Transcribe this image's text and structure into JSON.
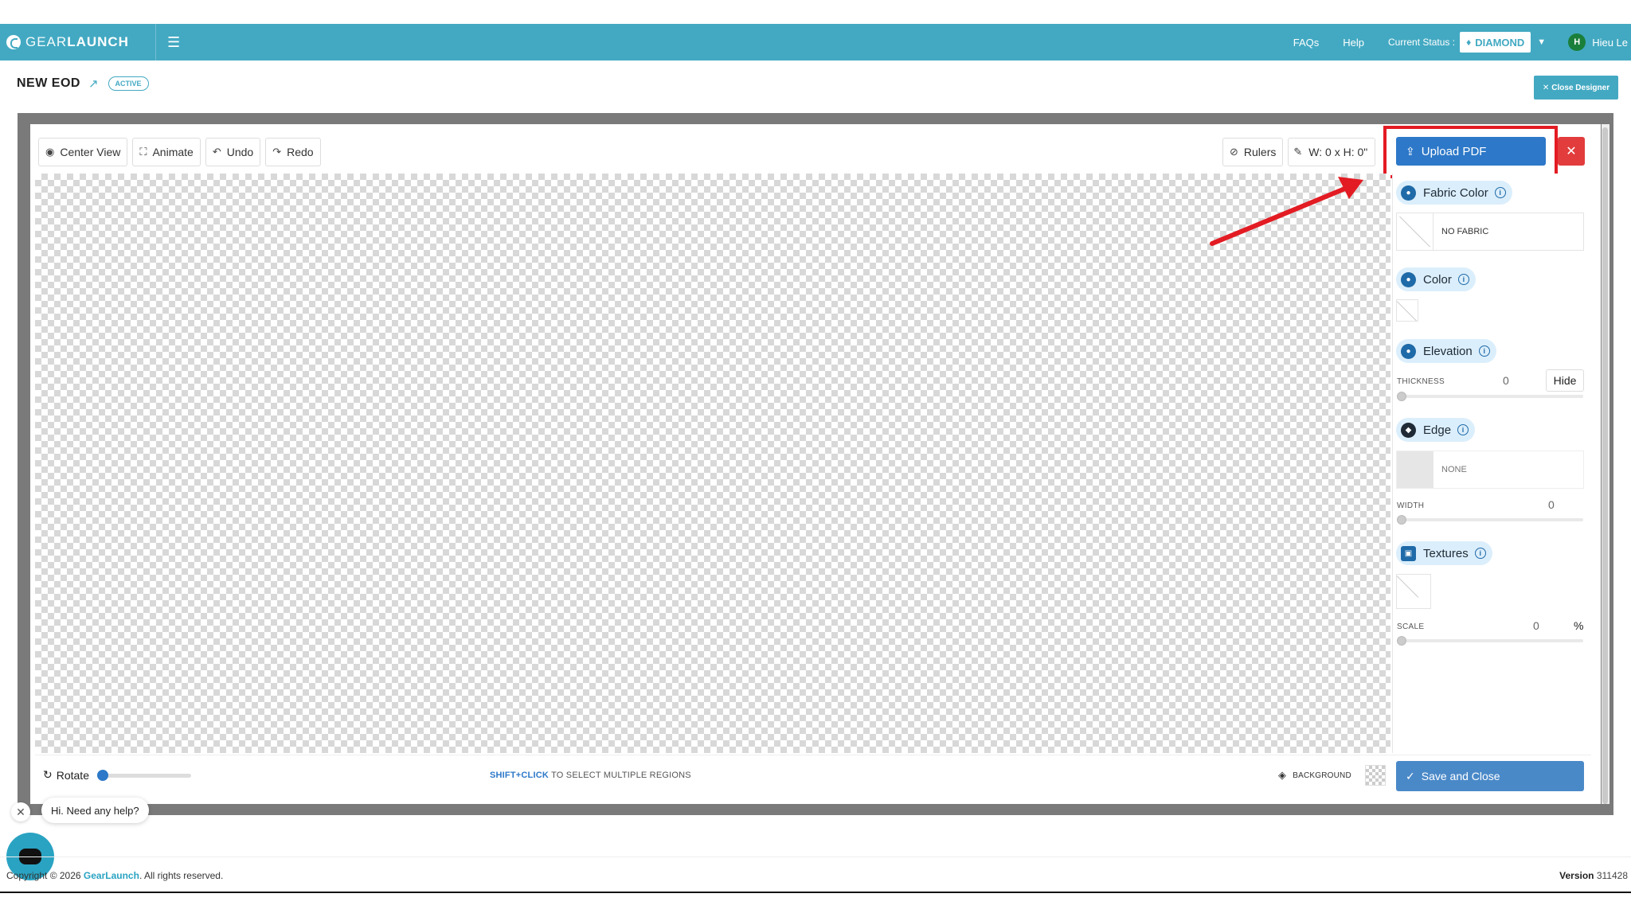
{
  "brand": {
    "part1": "GEAR",
    "part2": "LAUNCH"
  },
  "nav": {
    "faqs": "FAQs",
    "help": "Help",
    "status_label": "Current Status :",
    "status_value": "DIAMOND",
    "avatar_initial": "H",
    "user_name": "Hieu Le"
  },
  "page": {
    "title": "NEW EOD",
    "badge": "ACTIVE",
    "close_designer": "Close Designer"
  },
  "toolbar": {
    "center_view": "Center View",
    "animate": "Animate",
    "undo": "Undo",
    "redo": "Redo",
    "rulers": "Rulers",
    "dimensions": "W: 0 x H: 0\"",
    "upload_pdf": "Upload PDF"
  },
  "panel": {
    "fabric_color": {
      "title": "Fabric Color",
      "value": "NO FABRIC"
    },
    "color": {
      "title": "Color"
    },
    "elevation": {
      "title": "Elevation",
      "thickness_label": "THICKNESS",
      "thickness_value": "0",
      "hide_label": "Hide"
    },
    "edge": {
      "title": "Edge",
      "value": "NONE",
      "width_label": "WIDTH",
      "width_value": "0"
    },
    "textures": {
      "title": "Textures",
      "scale_label": "SCALE",
      "scale_value": "0",
      "scale_unit": "%"
    }
  },
  "bottom": {
    "rotate": "Rotate",
    "hint_key": "SHIFT+CLICK",
    "hint_text": " TO SELECT MULTIPLE REGIONS",
    "background": "BACKGROUND",
    "save_and_close": "Save and Close"
  },
  "chat": {
    "bubble": "Hi. Need any help?"
  },
  "footer": {
    "copyright_prefix": "Copyright © 2026 ",
    "company": "GearLaunch",
    "copyright_suffix": ". All rights reserved.",
    "version_label": "Version",
    "version_value": "311428"
  },
  "colors": {
    "header": "#43a9c2",
    "primary_button": "#2d78c8",
    "danger": "#e23c3c",
    "highlight": "#e31b23"
  }
}
